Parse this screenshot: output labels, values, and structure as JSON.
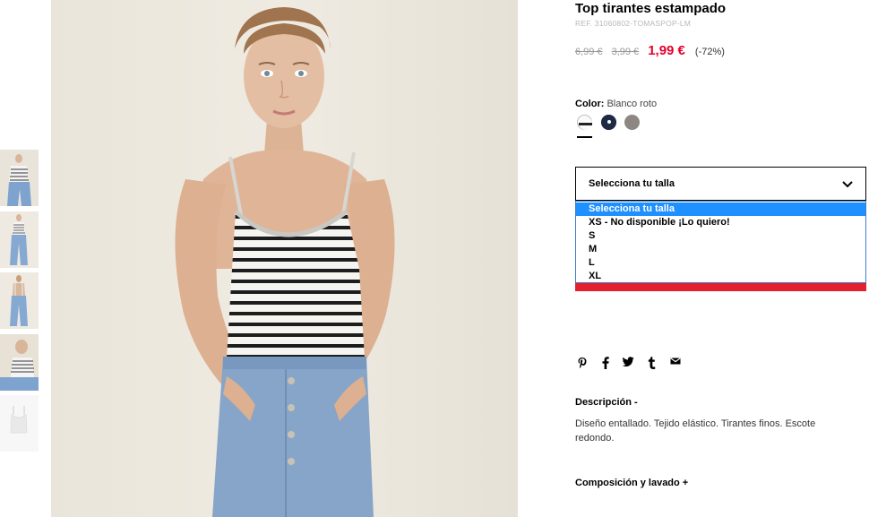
{
  "product": {
    "title": "Top tirantes estampado",
    "ref": "REF. 31060802-TOMASPOP-LM",
    "price_original": "6,99 €",
    "price_previous": "3,99 €",
    "price_current": "1,99 €",
    "discount": "(-72%)"
  },
  "color": {
    "label": "Color:",
    "selected": "Blanco roto",
    "swatches": [
      {
        "name": "Blanco roto",
        "hex": "#f2f2f2"
      },
      {
        "name": "Azul marino",
        "hex": "#1e2a44"
      },
      {
        "name": "Gris",
        "hex": "#8c8782"
      }
    ]
  },
  "size": {
    "select_label": "Selecciona tu talla",
    "options": [
      "Selecciona tu talla",
      "XS - No disponible ¡Lo quiero!",
      "S",
      "M",
      "L",
      "XL"
    ],
    "highlighted_index": 0
  },
  "share": {
    "icons": [
      "pinterest-icon",
      "facebook-icon",
      "twitter-icon",
      "tumblr-icon",
      "email-icon"
    ]
  },
  "description": {
    "heading": "Descripción -",
    "text": "Diseño entallado. Tejido elástico. Tirantes finos. Escote redondo."
  },
  "composition": {
    "heading": "Composición y lavado +"
  },
  "colors": {
    "sale_red": "#e4002b",
    "select_highlight": "#1e90ff",
    "accent_bar": "#e4202e"
  }
}
